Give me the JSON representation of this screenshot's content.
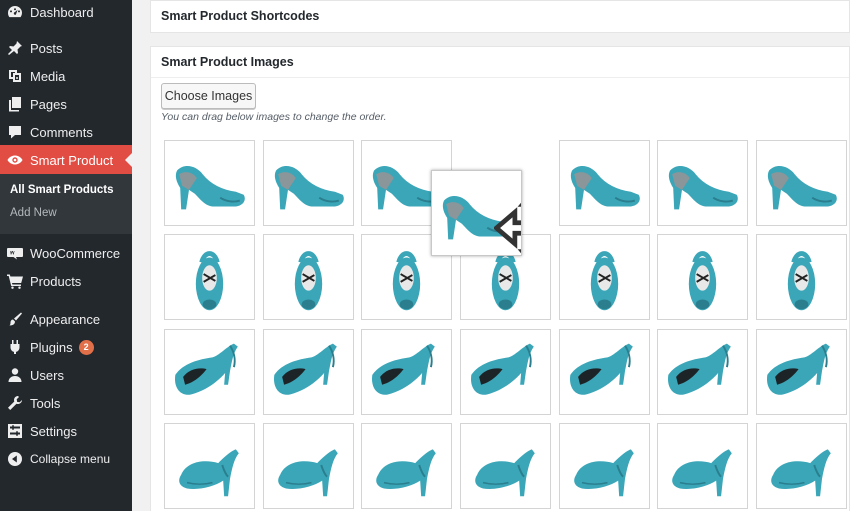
{
  "sidebar": {
    "items": [
      {
        "label": "Dashboard",
        "icon": "dashboard-icon"
      },
      {
        "label": "Posts",
        "icon": "pin-icon"
      },
      {
        "label": "Media",
        "icon": "media-icon"
      },
      {
        "label": "Pages",
        "icon": "pages-icon"
      },
      {
        "label": "Comments",
        "icon": "comment-icon"
      },
      {
        "label": "Smart Product",
        "icon": "eye-icon"
      },
      {
        "label": "WooCommerce",
        "icon": "woocommerce-icon"
      },
      {
        "label": "Products",
        "icon": "cart-icon"
      },
      {
        "label": "Appearance",
        "icon": "brush-icon"
      },
      {
        "label": "Plugins",
        "icon": "plug-icon",
        "badge": "2"
      },
      {
        "label": "Users",
        "icon": "user-icon"
      },
      {
        "label": "Tools",
        "icon": "wrench-icon"
      },
      {
        "label": "Settings",
        "icon": "settings-icon"
      },
      {
        "label": "Collapse menu",
        "icon": "collapse-icon"
      }
    ],
    "submenu": {
      "current": "All Smart Products",
      "add_new": "Add New"
    }
  },
  "main": {
    "shortcodes_title": "Smart Product Shortcodes",
    "images_title": "Smart Product Images",
    "choose_button": "Choose Images",
    "hint": "You can drag below images to change the order."
  },
  "colors": {
    "shoe": "#3aa6b8",
    "shoe_dark": "#2a7e8d",
    "active_menu": "#e14d43",
    "sidebar": "#23282d"
  },
  "grid": {
    "rows": 4,
    "columns": 7,
    "views_by_row": [
      "side",
      "front",
      "profile",
      "back"
    ],
    "dragged_view": "side"
  }
}
